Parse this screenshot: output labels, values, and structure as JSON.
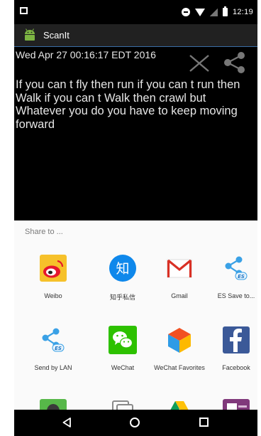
{
  "status_bar": {
    "time": "12:19"
  },
  "app_bar": {
    "title": "ScanIt"
  },
  "note": {
    "timestamp": "Wed Apr 27 00:16:17 EDT 2016",
    "text": "If you can t fly then run if you can t run then Walk if you can t Walk then crawl but Whatever you do you have to keep moving forward"
  },
  "share_sheet": {
    "title": "Share to ...",
    "apps": [
      {
        "label": "Weibo",
        "icon": "weibo-icon"
      },
      {
        "label": "知乎私信",
        "icon": "zhihu-icon"
      },
      {
        "label": "Gmail",
        "icon": "gmail-icon"
      },
      {
        "label": "ES Save to...",
        "icon": "es-save-icon"
      },
      {
        "label": "Send by LAN",
        "icon": "send-by-lan-icon"
      },
      {
        "label": "WeChat",
        "icon": "wechat-icon"
      },
      {
        "label": "WeChat Favorites",
        "icon": "wechat-favorites-icon"
      },
      {
        "label": "Facebook",
        "icon": "facebook-icon"
      }
    ]
  },
  "colors": {
    "divider": "#3a6ea5",
    "sheet_bg": "#fafafa",
    "facebook_blue": "#3b5998",
    "wechat_green": "#2dc100",
    "zhihu_blue": "#0f88eb"
  }
}
